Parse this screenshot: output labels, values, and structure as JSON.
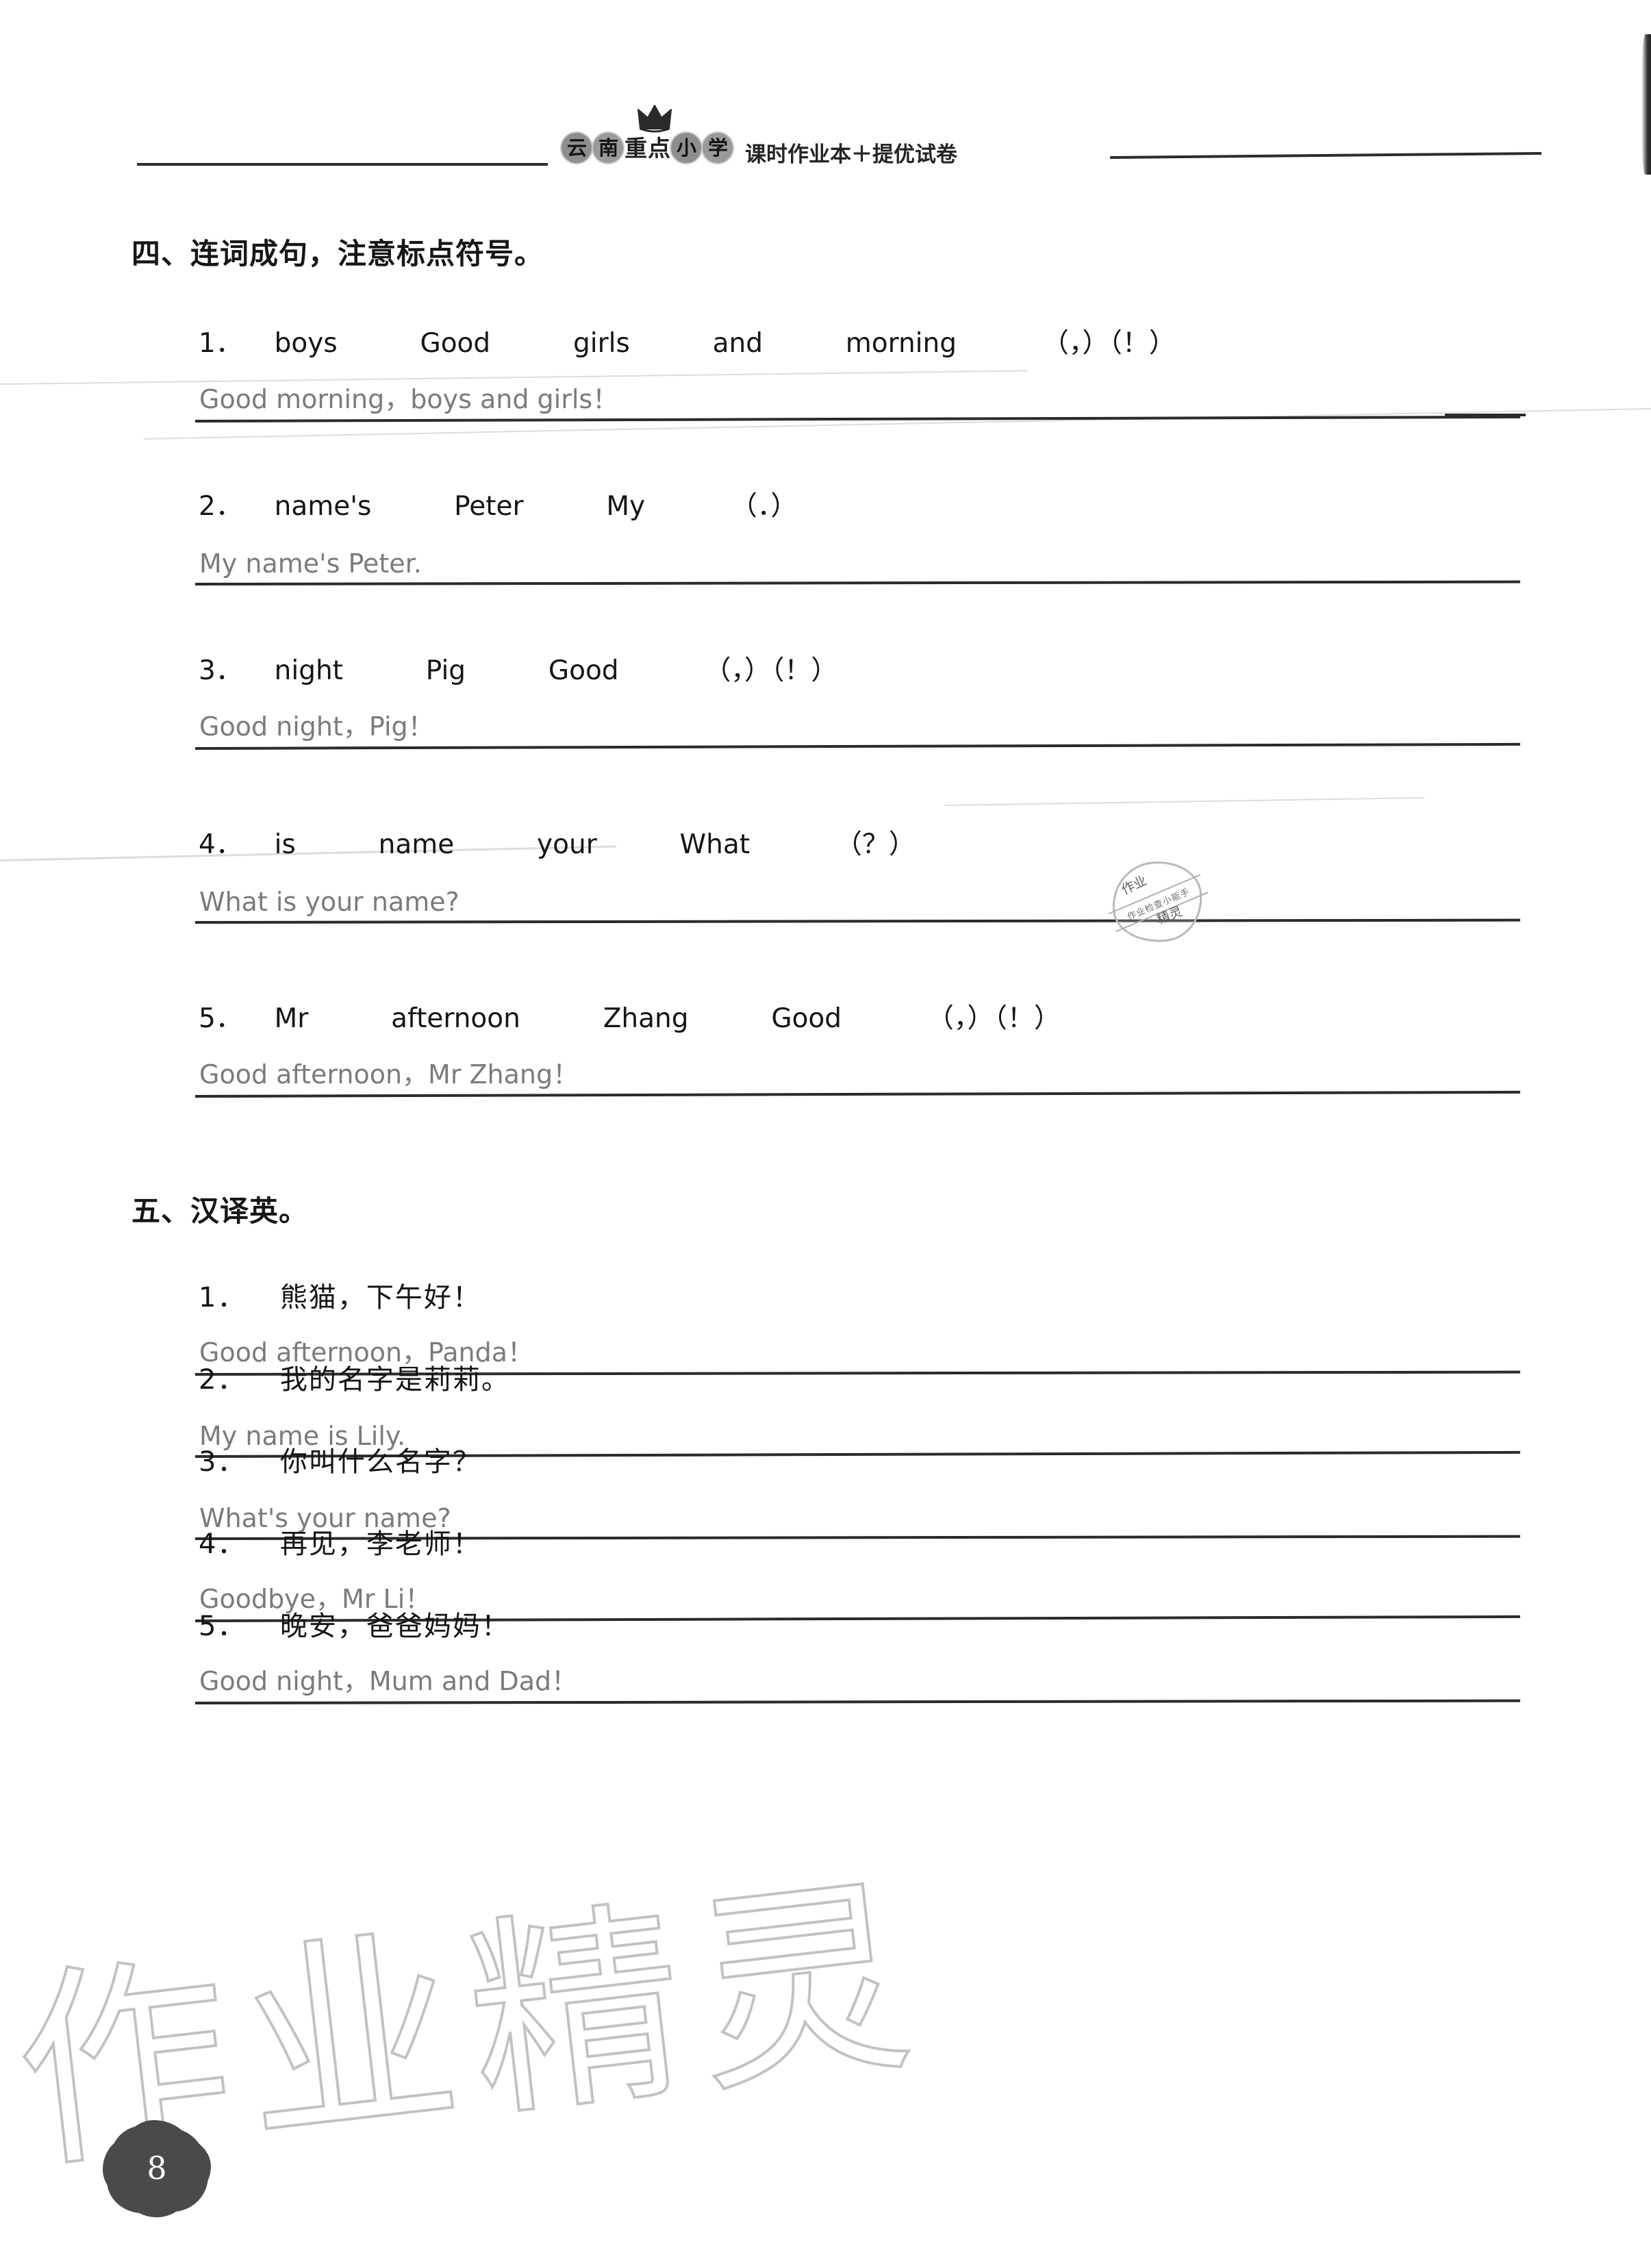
{
  "header": {
    "brand_chars": [
      "云",
      "南",
      "重",
      "点",
      "小",
      "学"
    ],
    "brand_subtitle": "课时作业本＋提优试卷",
    "crown_icon": "crown-icon"
  },
  "sections": [
    {
      "heading": "四、连词成句，注意标点符号。",
      "items": [
        {
          "number": "1．",
          "prompt_words": [
            "boys",
            "Good",
            "girls",
            "and",
            "morning"
          ],
          "punct_hint": "（，）（！）",
          "answer": "Good morning，boys and girls！"
        },
        {
          "number": "2．",
          "prompt_words": [
            "name's",
            "Peter",
            "My"
          ],
          "punct_hint": "（．）",
          "answer": "My name's Peter."
        },
        {
          "number": "3．",
          "prompt_words": [
            "night",
            "Pig",
            "Good"
          ],
          "punct_hint": "（，）（！）",
          "answer": "Good night，Pig！"
        },
        {
          "number": "4．",
          "prompt_words": [
            "is",
            "name",
            "your",
            "What"
          ],
          "punct_hint": "（？）",
          "answer": "What is your name?"
        },
        {
          "number": "5．",
          "prompt_words": [
            "Mr",
            "afternoon",
            "Zhang",
            "Good"
          ],
          "punct_hint": "（，）（！）",
          "answer": "Good afternoon，Mr Zhang！"
        }
      ]
    },
    {
      "heading": "五、汉译英。",
      "items": [
        {
          "number": "1．",
          "prompt": "熊猫，下午好！",
          "answer": "Good afternoon，Panda！"
        },
        {
          "number": "2．",
          "prompt": "我的名字是莉莉。",
          "answer": "My name is Lily."
        },
        {
          "number": "3．",
          "prompt": "你叫什么名字？",
          "answer": "What's your name?"
        },
        {
          "number": "4．",
          "prompt": "再见，李老师！",
          "answer": "Goodbye，Mr Li！"
        },
        {
          "number": "5．",
          "prompt": "晚安，爸爸妈妈！",
          "answer": "Good night，Mum and Dad！"
        }
      ]
    }
  ],
  "stamp": {
    "top_text": "作业",
    "band_text": "作业检查小能手",
    "bottom_text": "精灵"
  },
  "watermark": "作业精灵",
  "page_number": "8",
  "colors": {
    "ink": "#151515",
    "answer_gray": "#7b7b7b",
    "rule": "#2b2b2b",
    "watermark": "#c2c2c2",
    "page_blob": "#4a4a4a"
  }
}
